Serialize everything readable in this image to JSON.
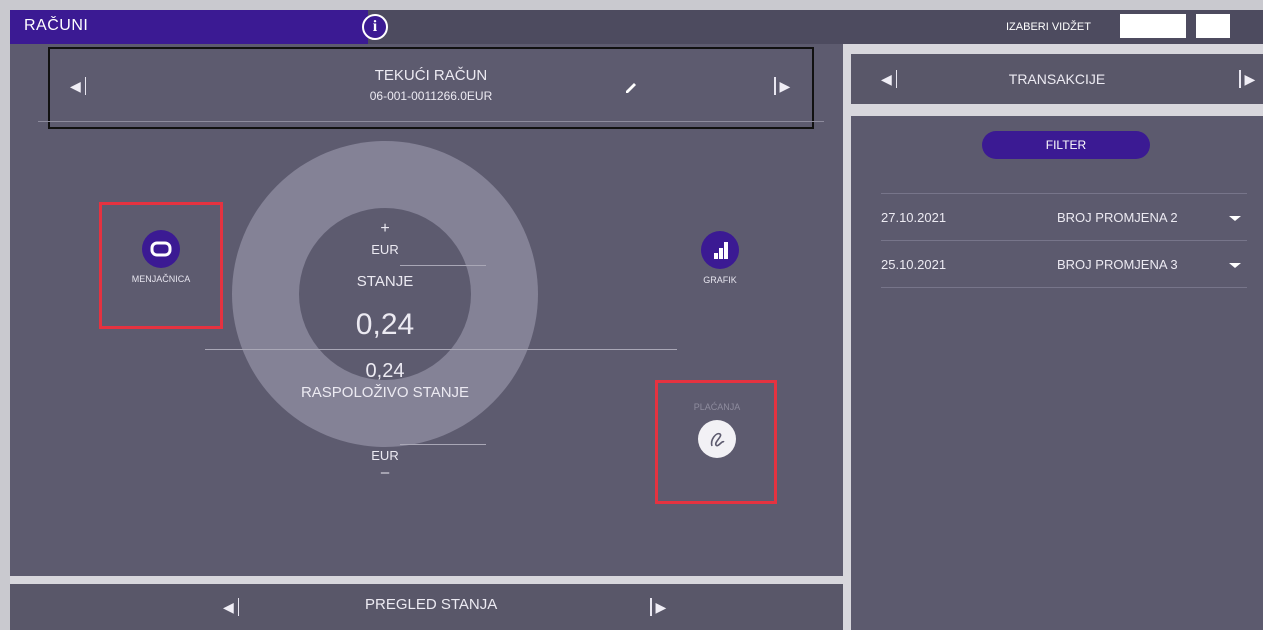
{
  "app": {
    "title": "RAČUNI",
    "info_glyph": "i"
  },
  "widget": {
    "label": "IZABERI VIDŽET"
  },
  "account": {
    "name": "TEKUĆI RAČUN",
    "number": "06-001-0011266.0EUR"
  },
  "balance": {
    "top_symbol": "+",
    "top_currency": "EUR",
    "label": "STANJE",
    "value": "0,24",
    "available_value": "0,24",
    "available_label": "RASPOLOŽIVO STANJE",
    "bottom_currency": "EUR",
    "bottom_symbol": "–"
  },
  "actions": {
    "exchange": {
      "label": "MENJAČNICA",
      "icon": "exchange-icon"
    },
    "chart": {
      "label": "GRAFIK",
      "icon": "bar-chart-icon"
    },
    "payments": {
      "label": "PLAĆANJA",
      "icon": "signature-icon"
    }
  },
  "footer": {
    "label": "PREGLED STANJA"
  },
  "transactions": {
    "title": "TRANSAKCIJE",
    "filter_label": "FILTER",
    "rows": [
      {
        "date": "27.10.2021",
        "label": "BROJ PROMJENA 2"
      },
      {
        "date": "25.10.2021",
        "label": "BROJ PROMJENA 3"
      }
    ]
  },
  "colors": {
    "accent": "#3b1a93",
    "panel": "#5c5a6e",
    "highlight_border": "#e53240",
    "frame": "#d8d7dd"
  }
}
